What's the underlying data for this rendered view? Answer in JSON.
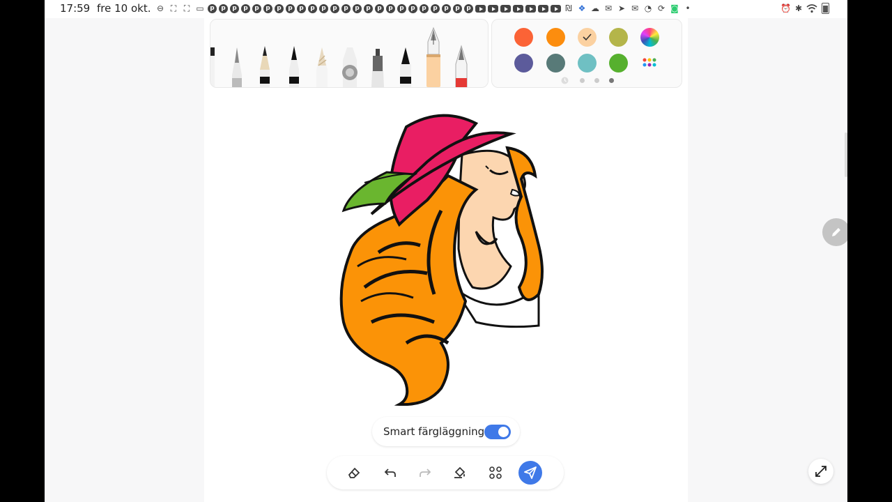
{
  "status_bar": {
    "time": "17:59",
    "date": "fre 10 okt.",
    "left_icons": [
      "dnd-icon",
      "screenshot-icon",
      "screen-record-icon",
      "cast-icon"
    ],
    "pinterest_count": 24,
    "youtube_count": 7,
    "misc_icons": [
      "sv-ru-icon",
      "dropbox-icon",
      "cloud-icon",
      "messenger-icon",
      "telegram-icon",
      "mail-icon",
      "vpn-icon",
      "sync-icon",
      "green-app-icon"
    ],
    "right_icons": [
      "alarm-icon",
      "bluetooth-icon",
      "wifi-icon",
      "battery-icon"
    ]
  },
  "pen_tray": {
    "tools": [
      "brush-partial",
      "fine-brush",
      "pencil",
      "calligraphy-pen",
      "crayon",
      "highlighter",
      "marker",
      "fine-marker",
      "fountain-pen",
      "red-pen"
    ],
    "selected_tool": "fountain-pen"
  },
  "palette": {
    "colors": [
      "#fb6336",
      "#fc8d0e",
      "#fbd1a1",
      "#b4b54a",
      "#5c5b9b",
      "#587a78",
      "#6fc0c3",
      "#56b02e"
    ],
    "selected_color": "#fbd1a1",
    "page_dots": 4,
    "active_page": 3
  },
  "drawing": {
    "hair_color": "#fb9307",
    "hat_color": "#e91e63",
    "leaf_color": "#6ab62f",
    "skin_color": "#fcd6b0"
  },
  "smart_coloring": {
    "label": "Smart färgläggning",
    "enabled": true
  },
  "bottom_toolbar": {
    "tools": [
      "eraser-icon",
      "undo-icon",
      "redo-icon",
      "fill-bucket-icon",
      "apps-icon",
      "send-icon"
    ]
  }
}
